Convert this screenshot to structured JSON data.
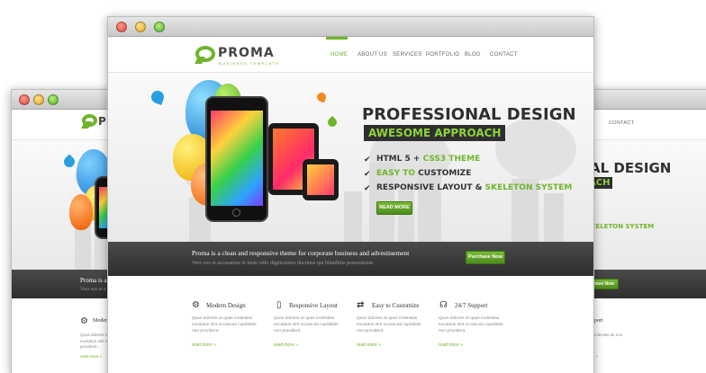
{
  "site": {
    "logo_text": "PROMA",
    "logo_sub": "BUSINESS TEMPLATE"
  },
  "nav": [
    {
      "label": "HOME",
      "active": true
    },
    {
      "label": "ABOUT US",
      "active": false
    },
    {
      "label": "SERVICES",
      "active": false
    },
    {
      "label": "PORTFOLIO",
      "active": false
    },
    {
      "label": "BLOG",
      "active": false
    },
    {
      "label": "CONTACT",
      "active": false
    }
  ],
  "hero": {
    "headline": "PROFESSIONAL DESIGN",
    "tagline": "AWESOME APPROACH",
    "bullets": [
      {
        "text": "HTML 5 + ",
        "highlight": "CSS3 THEME",
        "after": ""
      },
      {
        "text": "",
        "highlight": "EASY TO",
        "after": " CUSTOMIZE"
      },
      {
        "text": "RESPONSIVE LAYOUT & ",
        "highlight": "SKELETON SYSTEM",
        "after": ""
      }
    ],
    "cta": "READ MORE"
  },
  "band": {
    "title": "Proma is a clean and responsive theme for corporate business and advestisement",
    "subtitle": "Vero eos et accusamus et iusto odio dignissimos ducimus qui blanditiis praesentium",
    "button": "Purchase Now"
  },
  "features": [
    {
      "icon": "gear-icon",
      "title": "Modern Design",
      "text": "Quos dolores et quas molestias excepturi sint occaecati cupiditate non provident.",
      "link": "read more »"
    },
    {
      "icon": "phone-icon",
      "title": "Responsive Layout",
      "text": "Quos dolores et quas molestias excepturi sint occaecati cupiditate non provident.",
      "link": "read more »"
    },
    {
      "icon": "shuffle-icon",
      "title": "Easy to Customize",
      "text": "Quos dolores et quas molestias excepturi sint occaecati cupiditate non provident.",
      "link": "read more »"
    },
    {
      "icon": "headphones-icon",
      "title": "24/7 Support",
      "text": "Quos dolores et quas molestias excepturi sint occaecati cupiditate non provident.",
      "link": "read more »"
    }
  ],
  "left_window": {
    "band_title_partial": "Proma is a",
    "band_sub_partial": "Vero eos et a",
    "feature_title_partial": "Moder",
    "feature_text_partial": "Quos dolores et excepturi sint o provident.",
    "feature_link": "read more »"
  },
  "right_window": {
    "nav_partial": "CONTACT",
    "headline_partial": "AL DESIGN",
    "tagline_partial": "ACH",
    "bullet_partial": "SKELETON SYSTEM",
    "button_partial": "chase Now",
    "feature_title_partial": "pport",
    "feature_text_partial": "s molestias ati non",
    "feature_link": "ore »"
  },
  "colors": {
    "accent": "#6fb52c",
    "dark": "#2f2f2f",
    "band": "#3a3a3a"
  }
}
